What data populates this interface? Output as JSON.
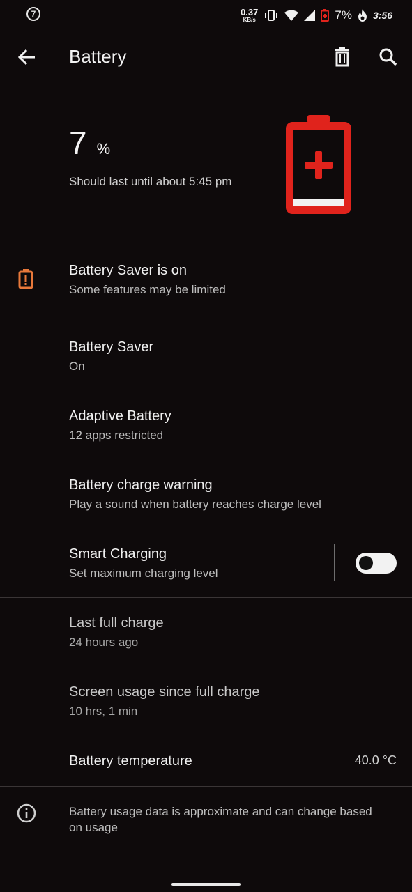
{
  "status_bar": {
    "notification_badge": "7",
    "net_speed_value": "0.37",
    "net_speed_unit": "KB/s",
    "battery_percent": "7%",
    "time": "3:56",
    "icons": [
      "vibrate-icon",
      "wifi-icon",
      "cell-signal-icon",
      "battery-saver-status-icon",
      "flame-icon"
    ]
  },
  "app_bar": {
    "title": "Battery",
    "icons": [
      "back-arrow-icon",
      "trash-icon",
      "search-icon"
    ]
  },
  "battery_header": {
    "level_number": "7",
    "level_unit": "%",
    "estimate": "Should last until about 5:45 pm",
    "accent_color": "#e0231c"
  },
  "items": {
    "saver_alert": {
      "title": "Battery Saver is on",
      "subtitle": "Some features may be limited",
      "icon_color": "#e8783a"
    },
    "battery_saver": {
      "title": "Battery Saver",
      "subtitle": "On"
    },
    "adaptive": {
      "title": "Adaptive Battery",
      "subtitle": "12 apps restricted"
    },
    "charge_warning": {
      "title": "Battery charge warning",
      "subtitle": "Play a sound when battery reaches charge level"
    },
    "smart_charging": {
      "title": "Smart Charging",
      "subtitle": "Set maximum charging level",
      "toggle_on": false
    },
    "last_full_charge": {
      "title": "Last full charge",
      "subtitle": "24 hours ago"
    },
    "screen_usage": {
      "title": "Screen usage since full charge",
      "subtitle": "10 hrs, 1 min"
    },
    "temperature": {
      "title": "Battery temperature",
      "value": "40.0 °C"
    }
  },
  "footer": {
    "text": "Battery usage data is approximate and can change based on usage"
  }
}
